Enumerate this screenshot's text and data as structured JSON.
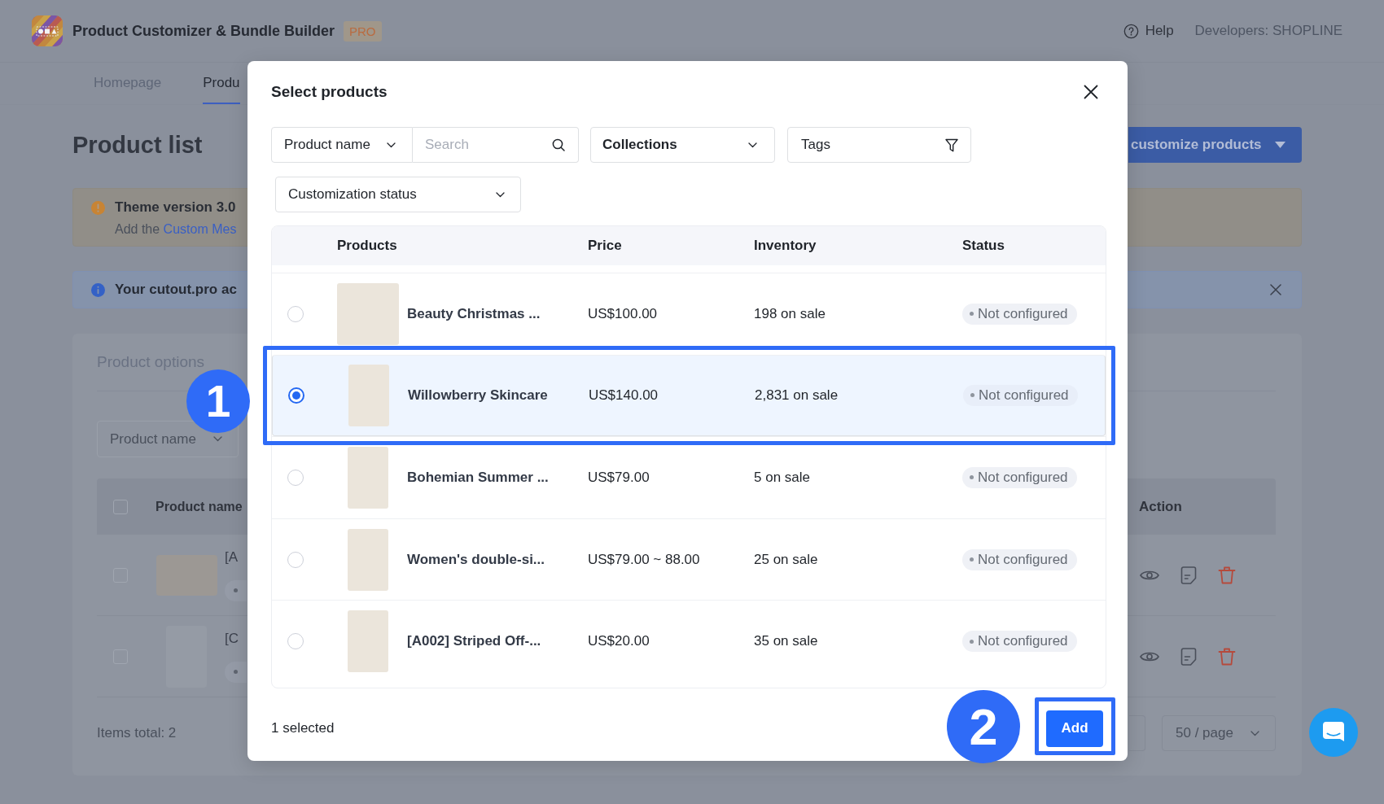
{
  "header": {
    "title": "Product Customizer & Bundle Builder",
    "plan_badge": "PRO",
    "help": "Help",
    "developer": "Developers: SHOPLINE"
  },
  "nav_tabs": [
    {
      "label": "Homepage",
      "selected": false
    },
    {
      "label": "Produ",
      "selected": true
    }
  ],
  "page": {
    "title": "Product list",
    "primary_button": "customize products"
  },
  "warning_banner": {
    "title": "Theme version 3.0",
    "text": "Add the",
    "link": "Custom Mes"
  },
  "info_banner": {
    "text": "Your cutout.pro ac"
  },
  "options_card": {
    "title": "Product options",
    "filter_select": "Product name",
    "table": {
      "select_all_checked": false,
      "columns": [
        "Product name",
        "Action"
      ],
      "rows": [
        {
          "kind": "wide",
          "checked": false,
          "name": "[A"
        },
        {
          "kind": "portrait",
          "checked": false,
          "name": "[C"
        }
      ]
    },
    "items_total": "Items total: 2",
    "page_size": "50 / page"
  },
  "modal": {
    "title": "Select products",
    "filters": {
      "field_select": "Product name",
      "search_placeholder": "Search",
      "collections": "Collections",
      "tags": "Tags",
      "customization_status": "Customization status"
    },
    "table": {
      "columns": [
        "Products",
        "Price",
        "Inventory",
        "Status"
      ],
      "rows": [
        {
          "kind": "square",
          "selected": false,
          "name": "Beauty Christmas ...",
          "price": "US$100.00",
          "inventory": "198 on sale",
          "status": "Not configured"
        },
        {
          "kind": "portrait",
          "selected": true,
          "name": "Willowberry Skincare",
          "price": "US$140.00",
          "inventory": "2,831 on sale",
          "status": "Not configured"
        },
        {
          "kind": "portrait",
          "selected": false,
          "name": "Bohemian Summer ...",
          "price": "US$79.00",
          "inventory": "5 on sale",
          "status": "Not configured"
        },
        {
          "kind": "portrait",
          "selected": false,
          "name": "Women's double-si...",
          "price": "US$79.00 ~ 88.00",
          "inventory": "25 on sale",
          "status": "Not configured"
        },
        {
          "kind": "portrait",
          "selected": false,
          "name": "[A002] Striped Off-...",
          "price": "US$20.00",
          "inventory": "35 on sale",
          "status": "Not configured"
        }
      ]
    },
    "selected_count": "1 selected",
    "add_button": "Add"
  },
  "steps": [
    {
      "number": "1"
    },
    {
      "number": "2"
    }
  ]
}
